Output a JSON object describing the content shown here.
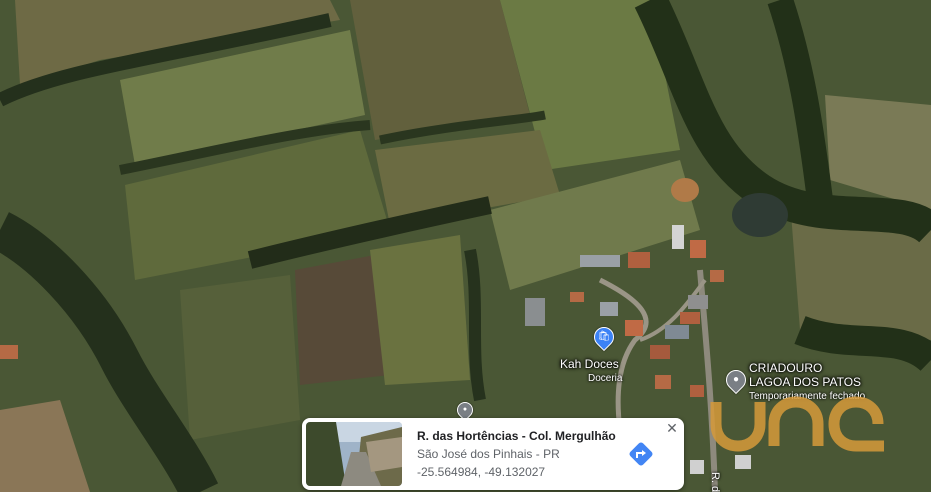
{
  "map": {
    "type": "satellite",
    "colors": {
      "field_dark": "#3f4a2d",
      "field_light": "#7a8452",
      "tree_line": "#24301c",
      "pin_shop": "#3b82f6",
      "pin_gray": "#7a7f85"
    }
  },
  "pois": {
    "kah_doces": {
      "name": "Kah Doces",
      "category": "Doceria",
      "icon": "shopping-bag-icon"
    },
    "criadouro": {
      "name_line1": "CRIADOURO",
      "name_line2": "LAGOA DOS PATOS",
      "status": "Temporariamente fechado",
      "icon": "location-pin-icon"
    },
    "dropped_pin": {
      "icon": "location-pin-icon"
    }
  },
  "road": {
    "label": "R. d"
  },
  "watermark": {
    "text": "una",
    "color": "#d69a3a"
  },
  "info_card": {
    "title": "R. das Hortências - Col. Mergulhão",
    "subtitle": "São José dos Pinhais - PR",
    "coordinates": "-25.564984, -49.132027",
    "close_icon": "close-icon",
    "directions_icon": "directions-icon",
    "accent_color": "#4285f4"
  }
}
